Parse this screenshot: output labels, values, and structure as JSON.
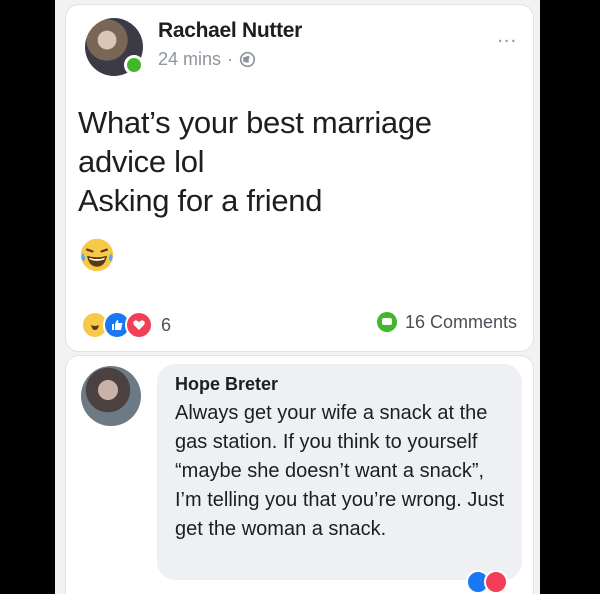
{
  "post": {
    "author": "Rachael Nutter",
    "time": "24 mins",
    "separator": "·",
    "more": "...",
    "text_lines": [
      "What’s your best marriage",
      "advice lol",
      "Asking for a friend"
    ],
    "reaction_count": "6",
    "comments_label": "16 Comments"
  },
  "comment": {
    "author": "Hope Breter",
    "text": "Always get your wife a snack at the gas station. If you think to yourself “maybe she doesn’t want a snack”, I’m telling you that you’re wrong. Just get the woman a snack."
  },
  "colors": {
    "online": "#42b72a",
    "like": "#1877f2",
    "love": "#f33e58",
    "haha": "#f7c948"
  }
}
